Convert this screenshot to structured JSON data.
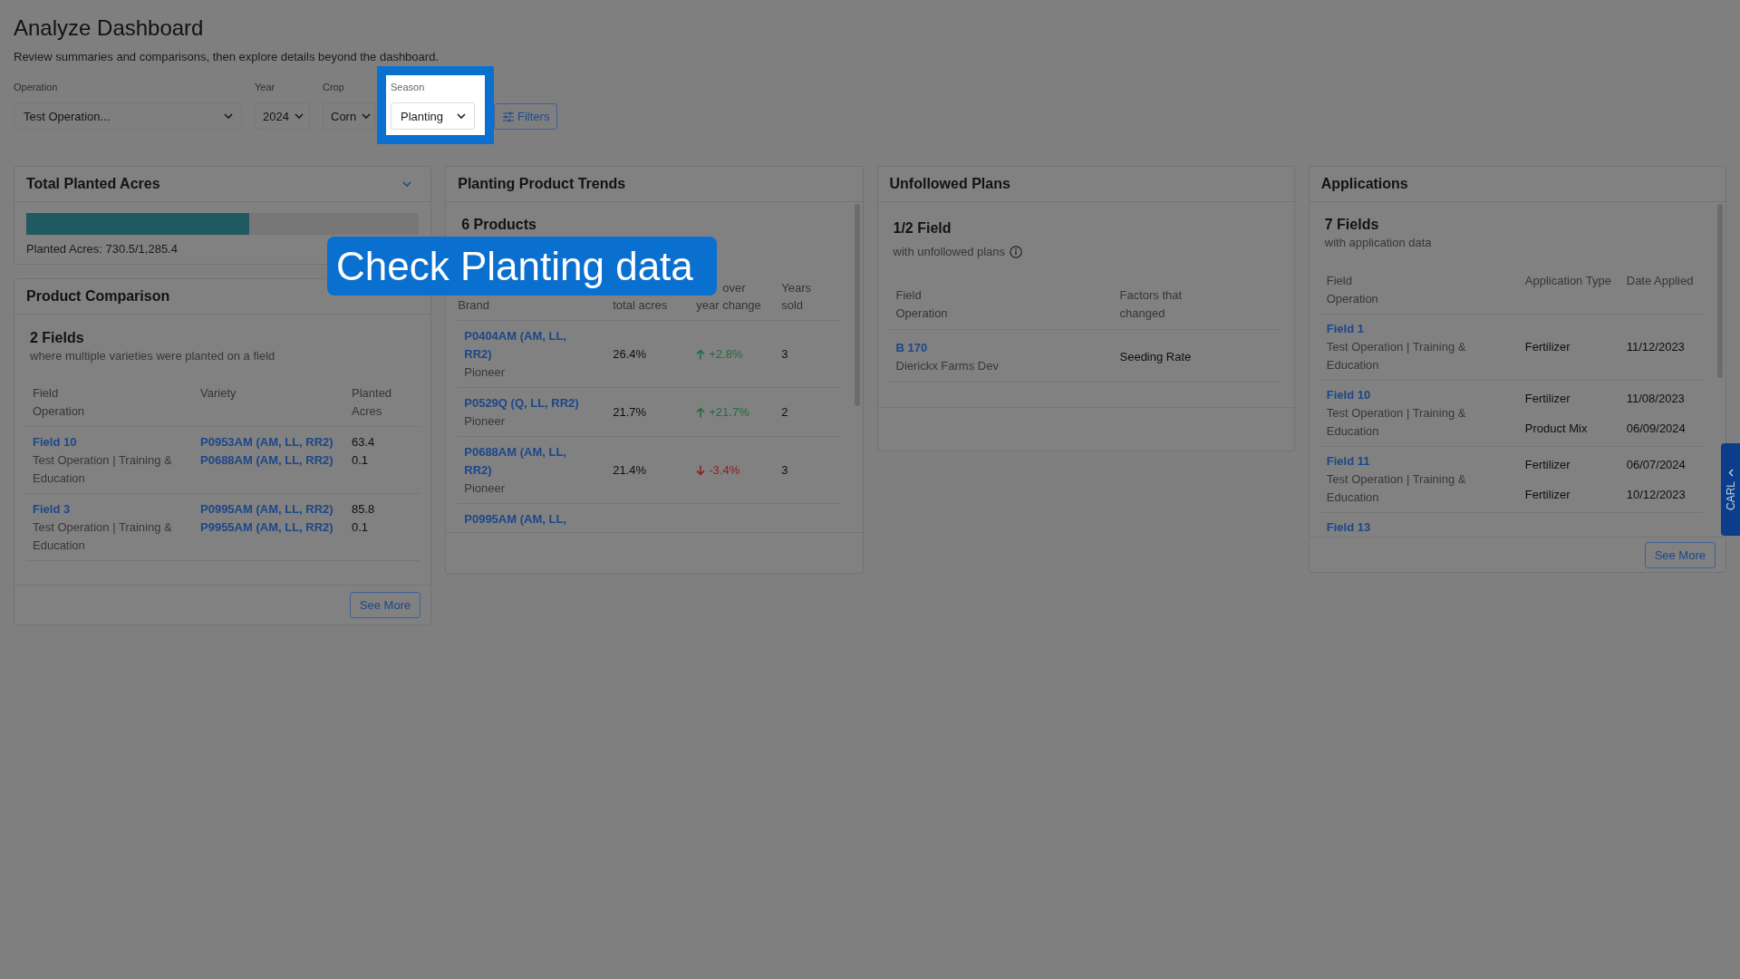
{
  "header": {
    "title": "Analyze Dashboard",
    "subtitle": "Review summaries and comparisons, then explore details beyond the dashboard."
  },
  "filters": [
    {
      "kind": "select",
      "label": "Operation",
      "value": "Test Operation...",
      "highlighted": false
    },
    {
      "kind": "select",
      "label": "Year",
      "value": "2024",
      "highlighted": false
    },
    {
      "kind": "select",
      "label": "Crop",
      "value": "Corn",
      "highlighted": false
    },
    {
      "kind": "select",
      "label": "Season",
      "value": "Planting",
      "highlighted": true
    },
    {
      "kind": "button",
      "label": "Filters",
      "highlighted": false
    }
  ],
  "total_planted_acres": {
    "title": "Total Planted Acres",
    "level": 0.568,
    "caption": "Planted Acres: 730.5/1,285.4"
  },
  "product_comparison": {
    "title": "Product Comparison",
    "count": "2 Fields",
    "description": "where multiple varieties were planted on a field",
    "columns": [
      {
        "lines": [
          "Field",
          "Operation"
        ]
      },
      {
        "lines": [
          "Variety"
        ]
      },
      {
        "lines": [
          "Planted",
          "Acres"
        ]
      }
    ],
    "rows": [
      {
        "field": "Field 10",
        "operation": "Test Operation | Training & Education",
        "varieties": [
          "P0953AM (AM, LL, RR2)",
          "P0688AM (AM, LL, RR2)"
        ],
        "acres": [
          "63.4",
          "0.1"
        ]
      },
      {
        "field": "Field 3",
        "operation": "Test Operation | Training & Education",
        "varieties": [
          "P0995AM (AM, LL, RR2)",
          "P9955AM (AM, LL, RR2)"
        ],
        "acres": [
          "85.8",
          "0.1"
        ]
      }
    ],
    "button": "See More"
  },
  "planting_product_trends": {
    "title": "Planting Product Trends",
    "count": "6 Products",
    "columns": [
      {
        "lines": [
          "Brand"
        ]
      },
      {
        "lines": [
          "total acres"
        ]
      },
      {
        "lines": [
          "over",
          "year change"
        ]
      },
      {
        "lines": [
          "Years",
          "sold"
        ]
      }
    ],
    "rows": [
      {
        "product": "P0404AM (AM, LL, RR2)",
        "brand": "Pioneer",
        "share": "26.4%",
        "change": "+2.8%",
        "rising": true,
        "years": "3"
      },
      {
        "product": "P0529Q (Q, LL, RR2)",
        "brand": "Pioneer",
        "share": "21.7%",
        "change": "+21.7%",
        "rising": true,
        "years": "2"
      },
      {
        "product": "P0688AM (AM, LL, RR2)",
        "brand": "Pioneer",
        "share": "21.4%",
        "change": "-3.4%",
        "rising": false,
        "years": "3"
      },
      {
        "product": "P0995AM (AM, LL,"
      }
    ]
  },
  "unfollowed_plans": {
    "title": "Unfollowed Plans",
    "count": "1/2 Field",
    "description": "with unfollowed plans",
    "columns": [
      {
        "lines": [
          "Field",
          "Operation"
        ]
      },
      {
        "lines": [
          "Factors that",
          "changed"
        ]
      }
    ],
    "rows": [
      {
        "field": "B 170",
        "operation": "Dierickx Farms Dev",
        "factors": "Seeding Rate"
      }
    ]
  },
  "applications": {
    "title": "Applications",
    "count": "7 Fields",
    "description": "with application data",
    "columns": [
      {
        "lines": [
          "Field",
          "Operation"
        ]
      },
      {
        "lines": [
          "Application Type"
        ]
      },
      {
        "lines": [
          "Date Applied"
        ]
      }
    ],
    "rows": [
      {
        "field": "Field 1",
        "operation": "Test Operation | Training & Education",
        "entries": [
          {
            "type": "Fertilizer",
            "date": "11/12/2023"
          }
        ]
      },
      {
        "field": "Field 10",
        "operation": "Test Operation | Training & Education",
        "entries": [
          {
            "type": "Fertilizer",
            "date": "11/08/2023"
          },
          {
            "type": "Product Mix",
            "date": "06/09/2024"
          }
        ]
      },
      {
        "field": "Field 11",
        "operation": "Test Operation | Training & Education",
        "entries": [
          {
            "type": "Fertilizer",
            "date": "06/07/2024"
          },
          {
            "type": "Fertilizer",
            "date": "10/12/2023"
          }
        ]
      },
      {
        "field": "Field 13"
      }
    ],
    "button": "See More"
  },
  "side_tab": {
    "label": "CARL"
  },
  "callout": {
    "text": "Check Planting data"
  }
}
